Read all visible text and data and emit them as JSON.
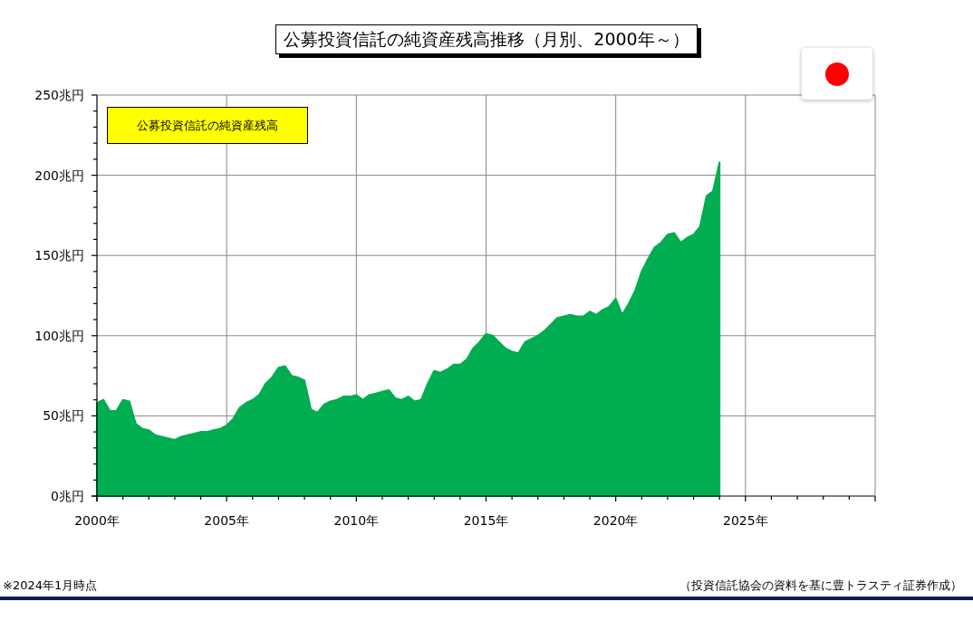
{
  "title": "公募投資信託の純資産残高推移（月別、2000年～）",
  "chart": {
    "chart_data": {
      "type": "area",
      "x": [
        2000,
        2000.25,
        2000.5,
        2000.75,
        2001,
        2001.25,
        2001.5,
        2001.75,
        2002,
        2002.25,
        2002.5,
        2002.75,
        2003,
        2003.25,
        2003.5,
        2003.75,
        2004,
        2004.25,
        2004.5,
        2004.75,
        2005,
        2005.25,
        2005.5,
        2005.75,
        2006,
        2006.25,
        2006.5,
        2006.75,
        2007,
        2007.25,
        2007.5,
        2007.75,
        2008,
        2008.25,
        2008.5,
        2008.75,
        2009,
        2009.25,
        2009.5,
        2009.75,
        2010,
        2010.25,
        2010.5,
        2010.75,
        2011,
        2011.25,
        2011.5,
        2011.75,
        2012,
        2012.25,
        2012.5,
        2012.75,
        2013,
        2013.25,
        2013.5,
        2013.75,
        2014,
        2014.25,
        2014.5,
        2014.75,
        2015,
        2015.25,
        2015.5,
        2015.75,
        2016,
        2016.25,
        2016.5,
        2016.75,
        2017,
        2017.25,
        2017.5,
        2017.75,
        2018,
        2018.25,
        2018.5,
        2018.75,
        2019,
        2019.25,
        2019.5,
        2019.75,
        2020,
        2020.25,
        2020.5,
        2020.75,
        2021,
        2021.25,
        2021.5,
        2021.75,
        2022,
        2022.25,
        2022.5,
        2022.75,
        2023,
        2023.25,
        2023.5,
        2023.75,
        2024
      ],
      "series": [
        {
          "name": "公募投資信託の純資産残高",
          "color": "#00ad50",
          "values": [
            58,
            60,
            53,
            53,
            60,
            59,
            45,
            42,
            41,
            38,
            37,
            36,
            35,
            37,
            38,
            39,
            40,
            40,
            41,
            42,
            44,
            48,
            55,
            58,
            60,
            63,
            70,
            74,
            80,
            81,
            75,
            74,
            72,
            54,
            52,
            57,
            59,
            60,
            62,
            62,
            63,
            60,
            63,
            64,
            65,
            66,
            61,
            60,
            62,
            59,
            60,
            70,
            78,
            77,
            79,
            82,
            82,
            85,
            92,
            96,
            101,
            100,
            96,
            92,
            90,
            89,
            96,
            98,
            100,
            103,
            107,
            111,
            112,
            113,
            112,
            112,
            115,
            113,
            116,
            118,
            123,
            113,
            120,
            128,
            140,
            148,
            155,
            158,
            163,
            164,
            158,
            161,
            163,
            168,
            187,
            190,
            208
          ]
        }
      ],
      "grid": true,
      "xlim": [
        2000,
        2030
      ],
      "ylim": [
        0,
        250
      ],
      "xticks": [
        {
          "value": 2000,
          "label": "2000年"
        },
        {
          "value": 2005,
          "label": "2005年"
        },
        {
          "value": 2010,
          "label": "2010年"
        },
        {
          "value": 2015,
          "label": "2015年"
        },
        {
          "value": 2020,
          "label": "2020年"
        },
        {
          "value": 2025,
          "label": "2025年"
        }
      ],
      "yticks": [
        {
          "value": 0,
          "label": "0兆円"
        },
        {
          "value": 50,
          "label": "50兆円"
        },
        {
          "value": 100,
          "label": "100兆円"
        },
        {
          "value": 150,
          "label": "150兆円"
        },
        {
          "value": 200,
          "label": "200兆円"
        },
        {
          "value": 250,
          "label": "250兆円"
        }
      ]
    }
  },
  "footnote": "※2024年1月時点",
  "source": "（投資信託協会の資料を基に豊トラスティ証券作成）"
}
